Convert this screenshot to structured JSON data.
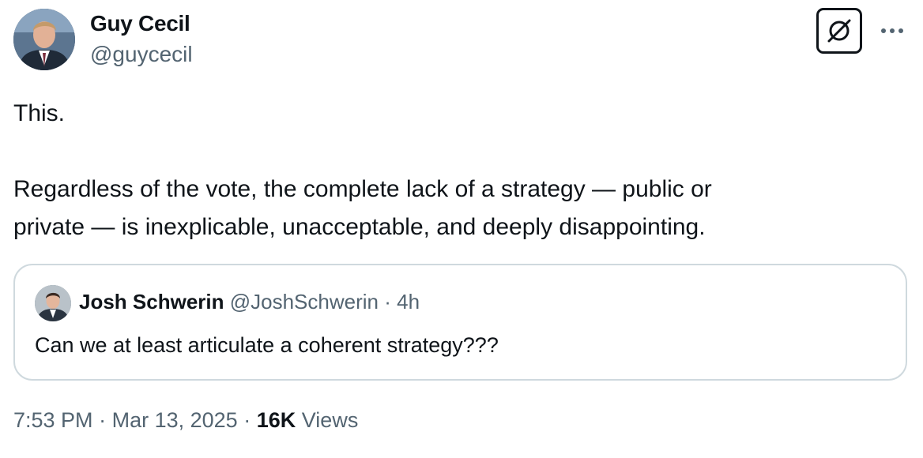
{
  "author": {
    "name": "Guy Cecil",
    "handle": "@guycecil"
  },
  "icons": {
    "grok": "grok-slash-icon",
    "more": "more-horizontal-icon"
  },
  "tweet": {
    "line1": "This.",
    "line2": "Regardless of the vote, the complete lack of a strategy — public or\nprivate — is inexplicable, unacceptable, and deeply disappointing."
  },
  "quote": {
    "name": "Josh Schwerin",
    "handle": "@JoshSchwerin",
    "separator": "·",
    "time": "4h",
    "text": "Can we at least articulate a coherent strategy???"
  },
  "meta": {
    "time": "7:53 PM",
    "sep1": "·",
    "date": "Mar 13, 2025",
    "sep2": "·",
    "views_count": "16K",
    "views_label": "Views"
  },
  "colors": {
    "text": "#0f1419",
    "secondary": "#536471",
    "border": "#cfd9de"
  }
}
